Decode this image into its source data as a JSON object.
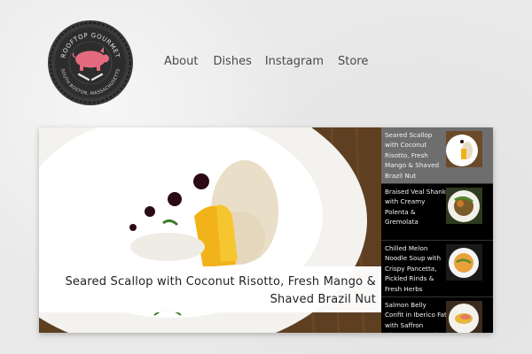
{
  "logo": {
    "top_text": "ROOFTOP GOURMET",
    "bottom_text": "SOUTH BOSTON, MASSACHUSETTS",
    "colors": {
      "badge": "#2f2f2f",
      "ring": "#d9d9d9",
      "pig": "#e46a7e"
    }
  },
  "nav": {
    "items": [
      {
        "label": "About"
      },
      {
        "label": "Dishes"
      },
      {
        "label": "Instagram"
      },
      {
        "label": "Store"
      }
    ]
  },
  "slider": {
    "caption": "Seared Scallop with Coconut Risotto, Fresh Mango & Shaved Brazil Nut",
    "thumbnails": [
      {
        "title": "Seared Scallop with Coconut Risotto, Fresh Mango & Shaved Brazil Nut",
        "active": true
      },
      {
        "title": "Braised Veal Shank with Creamy Polenta & Gremolata",
        "active": false
      },
      {
        "title": "Chilled Melon Noodle Soup with Crispy Pancetta, Pickled Rinds & Fresh Herbs",
        "active": false
      },
      {
        "title": "Salmon Belly Confit in Iberico Fat with Saffron Risotto & Fennel Salad",
        "active": false
      }
    ]
  }
}
